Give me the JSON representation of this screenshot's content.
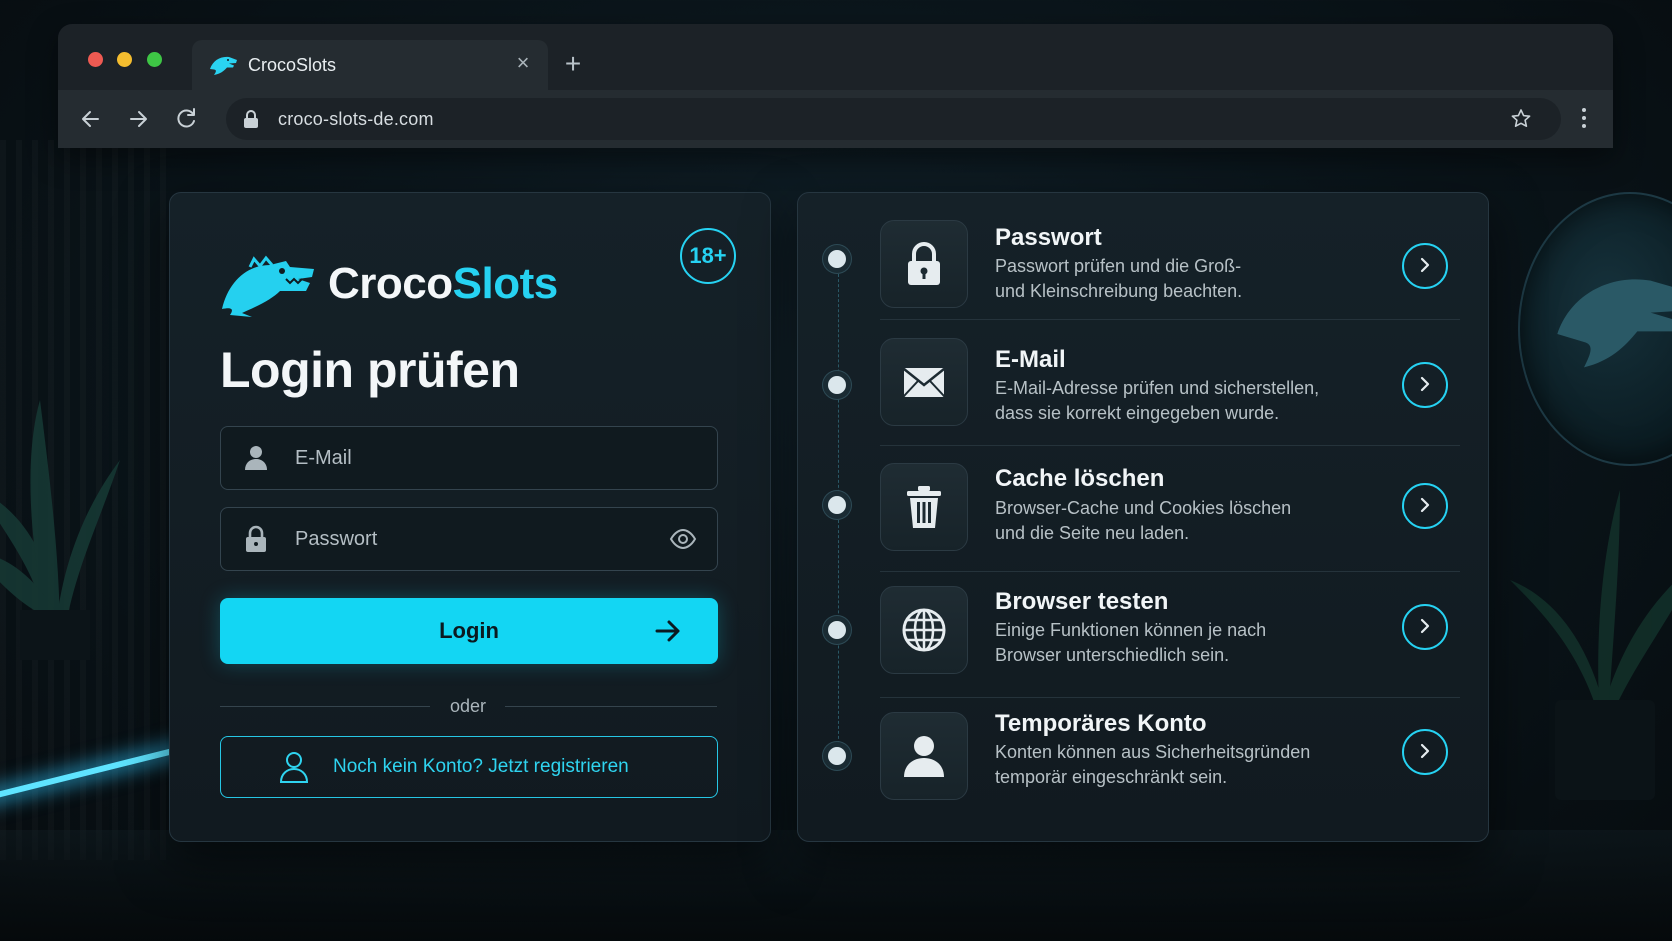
{
  "browser": {
    "tab_title": "CrocoSlots",
    "url": "croco-slots-de.com",
    "new_tab": "+",
    "close": "×"
  },
  "brand": {
    "name_part1": "Croco",
    "name_part2": "Slots",
    "age_badge": "18+",
    "accent_color": "#26d2f2"
  },
  "login": {
    "title": "Login prüfen",
    "email_placeholder": "E-Mail",
    "password_placeholder": "Passwort",
    "submit_label": "Login",
    "divider": "oder",
    "register_label": "Noch kein Konto? Jetzt registrieren"
  },
  "steps": [
    {
      "icon": "lock-icon",
      "title": "Passwort",
      "desc": "Passwort prüfen und die Groß-\nund Kleinschreibung beachten."
    },
    {
      "icon": "envelope-icon",
      "title": "E-Mail",
      "desc": "E-Mail-Adresse prüfen und sicherstellen,\ndass sie korrekt eingegeben wurde."
    },
    {
      "icon": "trash-icon",
      "title": "Cache löschen",
      "desc": "Browser-Cache und Cookies löschen\nund die Seite neu laden."
    },
    {
      "icon": "globe-icon",
      "title": "Browser testen",
      "desc": "Einige Funktionen können je nach\nBrowser unterschiedlich sein."
    },
    {
      "icon": "user-icon",
      "title": "Temporäres Konto",
      "desc": "Konten können aus Sicherheitsgründen\ntemporär eingeschränkt sein."
    }
  ]
}
